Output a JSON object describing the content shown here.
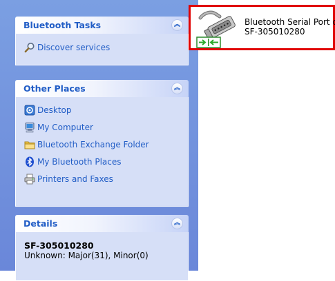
{
  "sidebar": {
    "bluetooth_tasks": {
      "title": "Bluetooth Tasks",
      "items": [
        {
          "label": "Discover services",
          "icon": "magnifier-icon"
        }
      ]
    },
    "other_places": {
      "title": "Other Places",
      "items": [
        {
          "label": "Desktop",
          "icon": "desktop-icon"
        },
        {
          "label": "My Computer",
          "icon": "my-computer-icon"
        },
        {
          "label": "Bluetooth Exchange Folder",
          "icon": "folder-icon"
        },
        {
          "label": "My Bluetooth Places",
          "icon": "bluetooth-icon"
        },
        {
          "label": "Printers and Faxes",
          "icon": "printer-icon"
        }
      ]
    },
    "details": {
      "title": "Details",
      "device_name": "SF-305010280",
      "device_info": "Unknown: Major(31), Minor(0)"
    }
  },
  "content": {
    "item": {
      "name": "Bluetooth Serial Port on",
      "device": "SF-305010280",
      "icon": "serial-port-connected-icon"
    }
  },
  "colors": {
    "sidebar_bg": "#7b9fe2",
    "panel_bg": "#d6dff7",
    "link": "#215dc6",
    "highlight": "#e00000"
  }
}
